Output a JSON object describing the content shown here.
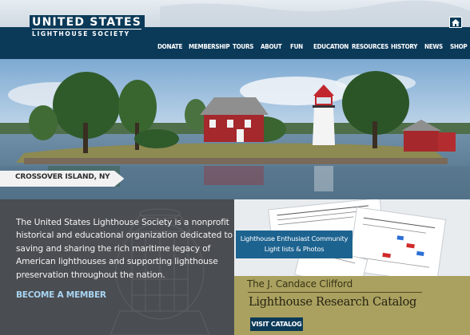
{
  "header": {
    "logo_line1": "UNITED STATES",
    "logo_line2": "LIGHTHOUSE SOCIETY",
    "home_icon": "home-icon"
  },
  "nav": {
    "items": [
      "DONATE",
      "MEMBERSHIP",
      "TOURS",
      "ABOUT",
      "FUN",
      "EDUCATION",
      "RESOURCES",
      "HISTORY",
      "NEWS",
      "SHOP"
    ]
  },
  "hero": {
    "caption": "CROSSOVER ISLAND, NY"
  },
  "about": {
    "text": "The United States Lighthouse Society is a nonprofit historical and educational organization dedicated to saving and sharing the rich maritime legacy of American lighthouses and supporting lighthouse preservation throughout the nation.",
    "cta": "BECOME A MEMBER"
  },
  "community": {
    "line1": "Lighthouse Enthusiast Community",
    "line2": "Light lists & Photos"
  },
  "catalog": {
    "pre_title": "The J. Candace Clifford",
    "title": "Lighthouse Research Catalog",
    "button": "VISIT CATALOG"
  },
  "colors": {
    "navy": "#0b3a59",
    "catalog_olive": "#aaa160",
    "about_gray": "#4a4d51",
    "badge_blue": "#1d6390",
    "link_blue": "#a8d4f2"
  }
}
